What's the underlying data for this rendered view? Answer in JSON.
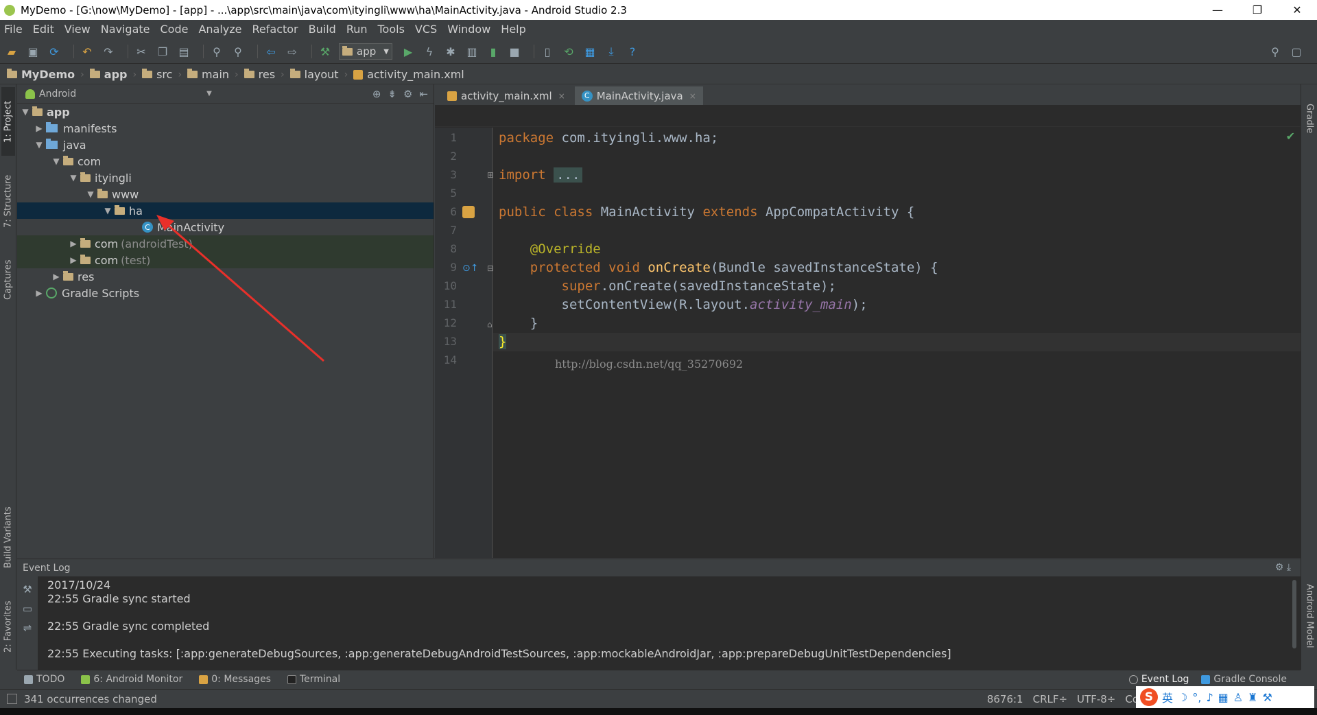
{
  "window": {
    "title": "MyDemo - [G:\\now\\MyDemo] - [app] - ...\\app\\src\\main\\java\\com\\ityingli\\www\\ha\\MainActivity.java - Android Studio 2.3",
    "minimize": "—",
    "restore": "❐",
    "close": "✕"
  },
  "menu": [
    "File",
    "Edit",
    "View",
    "Navigate",
    "Code",
    "Analyze",
    "Refactor",
    "Build",
    "Run",
    "Tools",
    "VCS",
    "Window",
    "Help"
  ],
  "toolbar": {
    "run_config": "app",
    "help": "?"
  },
  "breadcrumb": [
    "MyDemo",
    "app",
    "src",
    "main",
    "res",
    "layout",
    "activity_main.xml"
  ],
  "project": {
    "view_mode": "Android",
    "tree": [
      {
        "label": "app",
        "extra": ""
      },
      {
        "label": "manifests",
        "extra": ""
      },
      {
        "label": "java",
        "extra": ""
      },
      {
        "label": "com",
        "extra": ""
      },
      {
        "label": "ityingli",
        "extra": ""
      },
      {
        "label": "www",
        "extra": ""
      },
      {
        "label": "ha",
        "extra": ""
      },
      {
        "label": "MainActivity",
        "extra": ""
      },
      {
        "label": "com",
        "extra": "(androidTest)"
      },
      {
        "label": "com",
        "extra": "(test)"
      },
      {
        "label": "res",
        "extra": ""
      },
      {
        "label": "Gradle Scripts",
        "extra": ""
      }
    ],
    "class_badge": "C"
  },
  "editor": {
    "tabs": [
      {
        "label": "activity_main.xml",
        "close": "×"
      },
      {
        "label": "MainActivity.java",
        "close": "×"
      }
    ],
    "line_numbers": [
      "1",
      "2",
      "3",
      "5",
      "6",
      "7",
      "8",
      "9",
      "10",
      "11",
      "12",
      "13",
      "14"
    ],
    "code": {
      "l1_kw": "package",
      "l1_rest": " com.ityingli.www.ha;",
      "l3_kw": "import",
      "l3_fold": "...",
      "l6_kw1": "public class",
      "l6_name": " MainActivity ",
      "l6_kw2": "extends",
      "l6_rest": " AppCompatActivity {",
      "l8_ann": "    @Override",
      "l9_kw": "    protected void",
      "l9_fn": " onCreate",
      "l9_rest": "(Bundle savedInstanceState) {",
      "l10_kw": "        super",
      "l10_rest": ".onCreate(savedInstanceState);",
      "l11_pre": "        setContentView(R.layout.",
      "l11_it": "activity_main",
      "l11_post": ");",
      "l12": "    }",
      "l13": "}"
    },
    "watermark": "http://blog.csdn.net/qq_35270692",
    "check": "✔"
  },
  "left_tabs": [
    "1: Project",
    "7: Structure",
    "Captures",
    "Build Variants",
    "2: Favorites"
  ],
  "right_tabs": [
    "Gradle",
    "Android Model"
  ],
  "event_log": {
    "title": "Event Log",
    "entries": [
      "2017/10/24",
      "22:55  Gradle sync started",
      "",
      "22:55  Gradle sync completed",
      "",
      "22:55  Executing tasks: [:app:generateDebugSources, :app:generateDebugAndroidTestSources, :app:mockableAndroidJar, :app:prepareDebugUnitTestDependencies]"
    ]
  },
  "tool_windows": {
    "left": [
      "TODO",
      "6: Android Monitor",
      "0: Messages",
      "Terminal"
    ],
    "right": [
      "Event Log",
      "Gradle Console"
    ]
  },
  "status": {
    "message": "341 occurrences changed",
    "position": "8676:1",
    "line_sep": "CRLF÷",
    "encoding": "UTF-8÷",
    "context": "Co"
  },
  "ime": {
    "logo": "S",
    "lang": "英"
  }
}
